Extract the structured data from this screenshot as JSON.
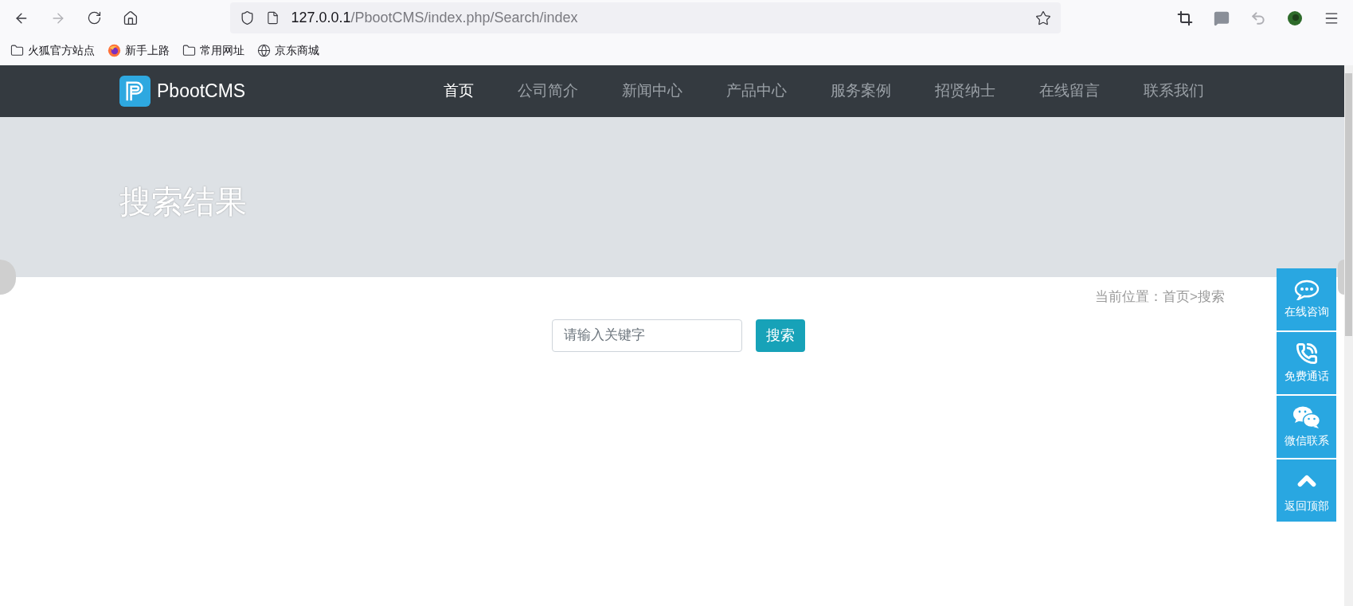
{
  "browser": {
    "url_host": "127.0.0.1",
    "url_path": "/PbootCMS/index.php/Search/index",
    "bookmarks": [
      {
        "kind": "folder",
        "label": "火狐官方站点"
      },
      {
        "kind": "firefox",
        "label": "新手上路"
      },
      {
        "kind": "folder",
        "label": "常用网址"
      },
      {
        "kind": "globe",
        "label": "京东商城"
      }
    ]
  },
  "site": {
    "logo": "PbootCMS",
    "nav": [
      {
        "label": "首页",
        "selected": true
      },
      {
        "label": "公司简介",
        "selected": false
      },
      {
        "label": "新闻中心",
        "selected": false
      },
      {
        "label": "产品中心",
        "selected": false
      },
      {
        "label": "服务案例",
        "selected": false
      },
      {
        "label": "招贤纳士",
        "selected": false
      },
      {
        "label": "在线留言",
        "selected": false
      },
      {
        "label": "联系我们",
        "selected": false
      }
    ],
    "banner_title": "搜索结果",
    "breadcrumb": {
      "label": "当前位置：",
      "items": [
        "首页",
        "搜索"
      ],
      "separator": ">"
    },
    "search": {
      "placeholder": "请输入关键字",
      "button": "搜索"
    },
    "side_buttons": [
      {
        "kind": "chat",
        "label": "在线咨询"
      },
      {
        "kind": "phone",
        "label": "免费通话"
      },
      {
        "kind": "wechat",
        "label": "微信联系"
      },
      {
        "kind": "top",
        "label": "返回顶部"
      }
    ]
  }
}
